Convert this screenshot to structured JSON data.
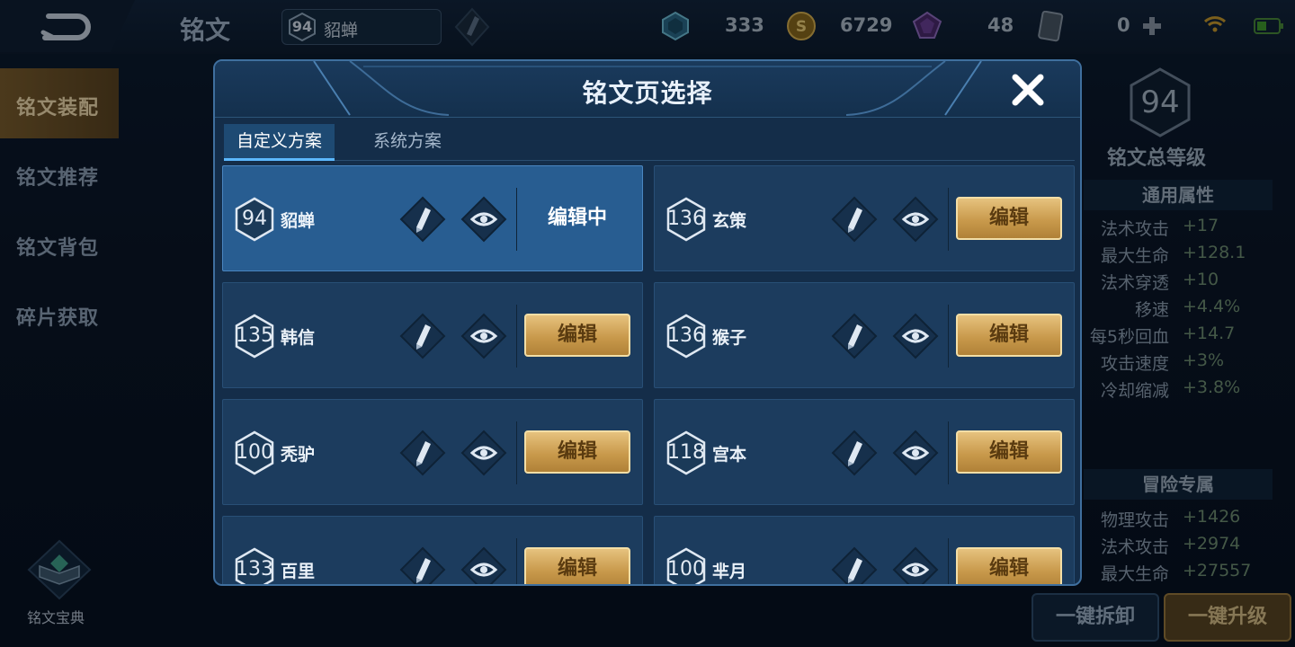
{
  "topbar": {
    "title": "铭文",
    "current_page": {
      "level": "94",
      "name": "貂蝉"
    },
    "resources": [
      {
        "icon": "gem-icon",
        "value": "333"
      },
      {
        "icon": "gold-coin-icon",
        "value": "6729"
      },
      {
        "icon": "crystal-icon",
        "value": "48"
      },
      {
        "icon": "card-icon",
        "value": "0"
      }
    ]
  },
  "sidebar": {
    "items": [
      {
        "label": "铭文装配",
        "active": true
      },
      {
        "label": "铭文推荐",
        "active": false
      },
      {
        "label": "铭文背包",
        "active": false
      },
      {
        "label": "碎片获取",
        "active": false
      }
    ],
    "codex_label": "铭文宝典"
  },
  "right_panel": {
    "total_level": "94",
    "total_label": "铭文总等级",
    "general_title": "通用属性",
    "general_attrs": [
      {
        "name": "法术攻击",
        "value": "+17"
      },
      {
        "name": "最大生命",
        "value": "+128.1"
      },
      {
        "name": "法术穿透",
        "value": "+10"
      },
      {
        "name": "移速",
        "value": "+4.4%"
      },
      {
        "name": "每5秒回血",
        "value": "+14.7"
      },
      {
        "name": "攻击速度",
        "value": "+3%"
      },
      {
        "name": "冷却缩减",
        "value": "+3.8%"
      }
    ],
    "adventure_title": "冒险专属",
    "adventure_attrs": [
      {
        "name": "物理攻击",
        "value": "+1426"
      },
      {
        "name": "法术攻击",
        "value": "+2974"
      },
      {
        "name": "最大生命",
        "value": "+27557"
      }
    ],
    "unequip_all": "一键拆卸",
    "upgrade_all": "一键升级"
  },
  "modal": {
    "title": "铭文页选择",
    "tabs": [
      {
        "label": "自定义方案",
        "active": true
      },
      {
        "label": "系统方案",
        "active": false
      }
    ],
    "cards": [
      {
        "level": "94",
        "name": "貂蝉",
        "status": "编辑中",
        "active": true
      },
      {
        "level": "136",
        "name": "玄策",
        "status": "编辑",
        "active": false
      },
      {
        "level": "135",
        "name": "韩信",
        "status": "编辑",
        "active": false
      },
      {
        "level": "136",
        "name": "猴子",
        "status": "编辑",
        "active": false
      },
      {
        "level": "100",
        "name": "秃驴",
        "status": "编辑",
        "active": false
      },
      {
        "level": "118",
        "name": "宫本",
        "status": "编辑",
        "active": false
      },
      {
        "level": "133",
        "name": "百里",
        "status": "编辑",
        "active": false
      },
      {
        "level": "100",
        "name": "芈月",
        "status": "编辑",
        "active": false
      }
    ]
  },
  "colors": {
    "accent_gold": "#d4aa5e",
    "panel_blue": "#1c3c5e",
    "active_blue": "#285d91",
    "tab_highlight": "#5cb8ff"
  }
}
